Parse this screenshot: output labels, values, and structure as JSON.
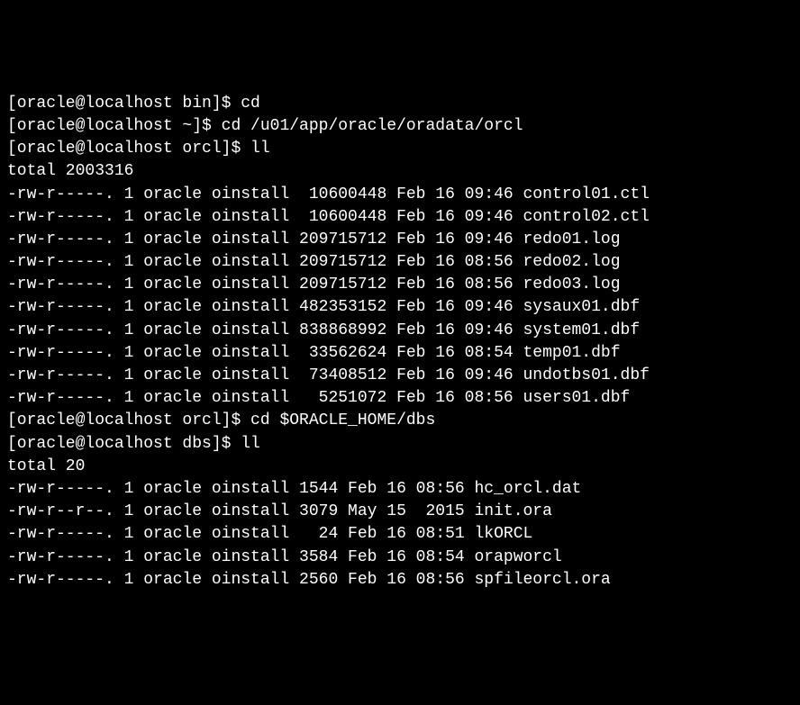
{
  "lines": [
    "[oracle@localhost bin]$ cd",
    "[oracle@localhost ~]$ cd /u01/app/oracle/oradata/orcl",
    "[oracle@localhost orcl]$ ll",
    "total 2003316",
    "-rw-r-----. 1 oracle oinstall  10600448 Feb 16 09:46 control01.ctl",
    "-rw-r-----. 1 oracle oinstall  10600448 Feb 16 09:46 control02.ctl",
    "-rw-r-----. 1 oracle oinstall 209715712 Feb 16 09:46 redo01.log",
    "-rw-r-----. 1 oracle oinstall 209715712 Feb 16 08:56 redo02.log",
    "-rw-r-----. 1 oracle oinstall 209715712 Feb 16 08:56 redo03.log",
    "-rw-r-----. 1 oracle oinstall 482353152 Feb 16 09:46 sysaux01.dbf",
    "-rw-r-----. 1 oracle oinstall 838868992 Feb 16 09:46 system01.dbf",
    "-rw-r-----. 1 oracle oinstall  33562624 Feb 16 08:54 temp01.dbf",
    "-rw-r-----. 1 oracle oinstall  73408512 Feb 16 09:46 undotbs01.dbf",
    "-rw-r-----. 1 oracle oinstall   5251072 Feb 16 08:56 users01.dbf",
    "[oracle@localhost orcl]$ cd $ORACLE_HOME/dbs",
    "[oracle@localhost dbs]$ ll",
    "total 20",
    "-rw-r-----. 1 oracle oinstall 1544 Feb 16 08:56 hc_orcl.dat",
    "-rw-r--r--. 1 oracle oinstall 3079 May 15  2015 init.ora",
    "-rw-r-----. 1 oracle oinstall   24 Feb 16 08:51 lkORCL",
    "-rw-r-----. 1 oracle oinstall 3584 Feb 16 08:54 orapworcl",
    "-rw-r-----. 1 oracle oinstall 2560 Feb 16 08:56 spfileorcl.ora"
  ]
}
